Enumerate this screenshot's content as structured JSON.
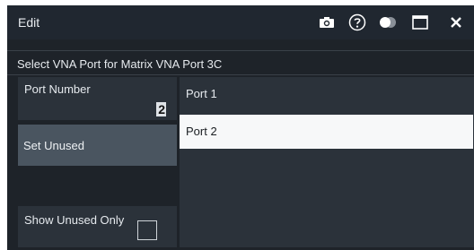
{
  "window": {
    "title": "Edit",
    "icons": [
      "camera-icon",
      "help-icon",
      "toggle-icon",
      "maximize-icon",
      "close-icon"
    ]
  },
  "header": {
    "text": "Select VNA Port for Matrix VNA Port 3C"
  },
  "left_panel": {
    "port_number_label": "Port Number",
    "port_number_value": "2",
    "set_unused_label": "Set Unused",
    "show_unused_only_label": "Show Unused Only",
    "show_unused_only_checked": false
  },
  "port_list": {
    "items": [
      {
        "label": "Port 1",
        "selected": false
      },
      {
        "label": "Port 2",
        "selected": true
      }
    ]
  },
  "colors": {
    "window_bg": "#1e2329",
    "titlebar_bg": "#202730",
    "panel_bg": "#2b323a",
    "button_bg": "#4a5560",
    "selected_bg": "#f7f8f9"
  }
}
